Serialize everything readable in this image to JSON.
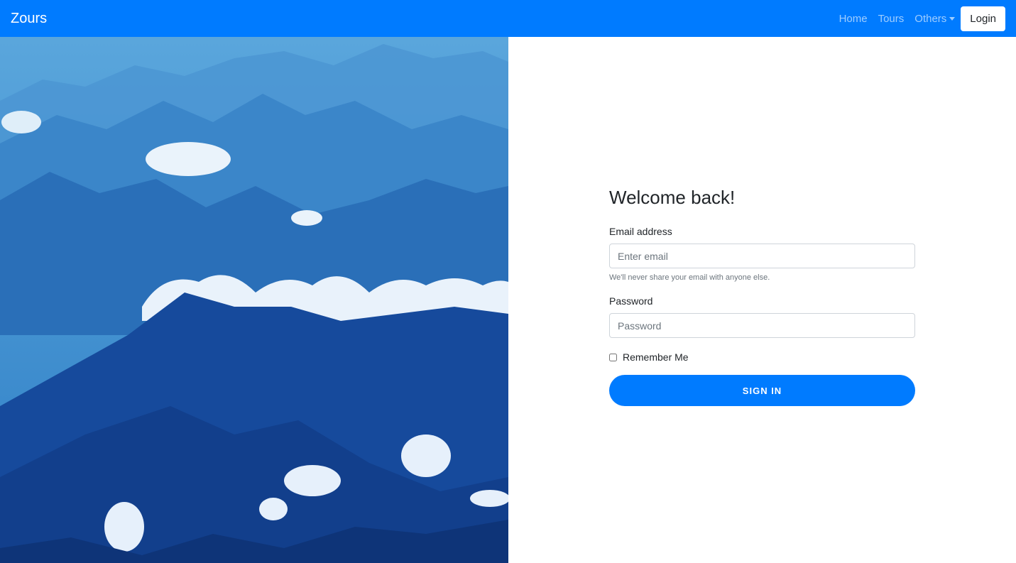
{
  "navbar": {
    "brand": "Zours",
    "links": [
      {
        "label": "Home"
      },
      {
        "label": "Tours"
      },
      {
        "label": "Others"
      }
    ],
    "login_label": "Login",
    "background_color": "#007bff"
  },
  "form": {
    "title": "Welcome back!",
    "email_label": "Email address",
    "email_placeholder": "Enter email",
    "email_help": "We'll never share your email with anyone else.",
    "password_label": "Password",
    "password_placeholder": "Password",
    "remember_label": "Remember Me",
    "submit_label": "SIGN IN",
    "accent_color": "#007bff"
  }
}
